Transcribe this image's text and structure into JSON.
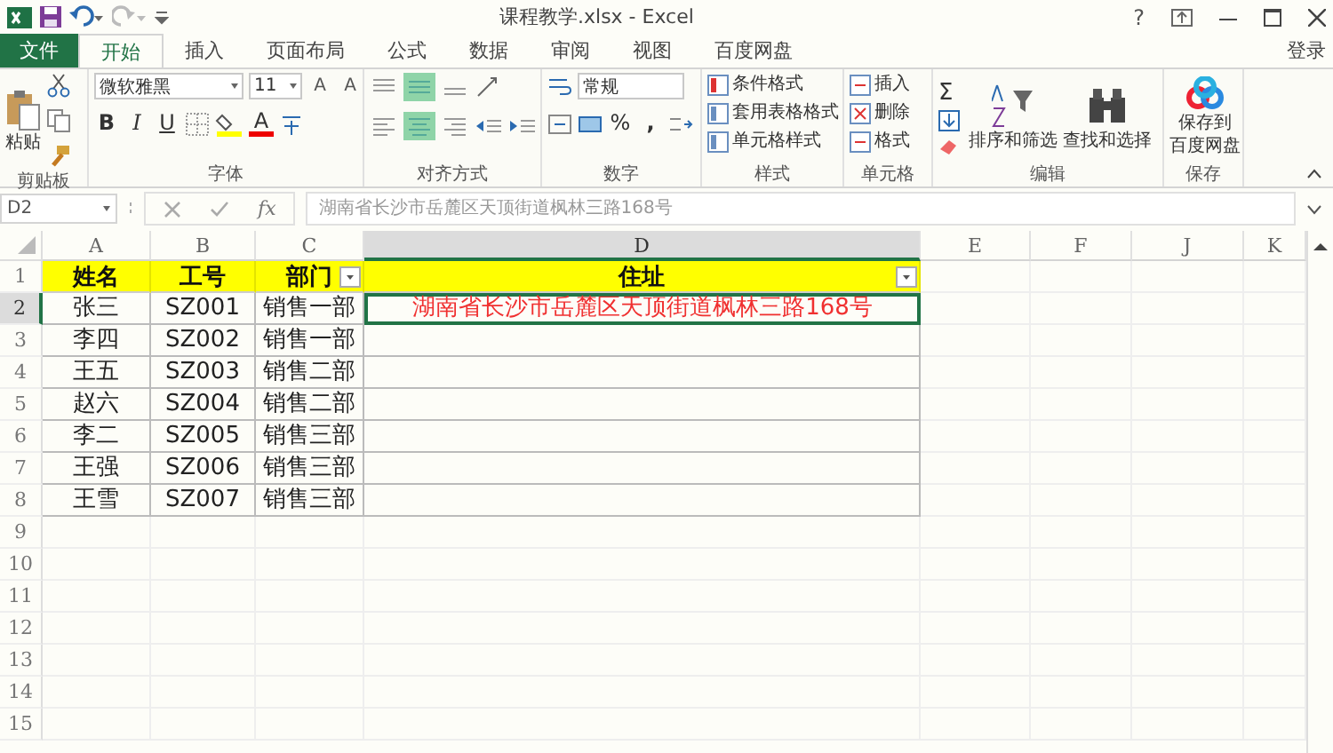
{
  "window": {
    "title": "课程教学.xlsx - Excel",
    "help": "?"
  },
  "tabs": [
    {
      "label": "文件",
      "kind": "file",
      "selected": false
    },
    {
      "label": "开始",
      "kind": "tab",
      "selected": true
    },
    {
      "label": "插入",
      "kind": "tab",
      "selected": false
    },
    {
      "label": "页面布局",
      "kind": "tab",
      "selected": false
    },
    {
      "label": "公式",
      "kind": "tab",
      "selected": false
    },
    {
      "label": "数据",
      "kind": "tab",
      "selected": false
    },
    {
      "label": "审阅",
      "kind": "tab",
      "selected": false
    },
    {
      "label": "视图",
      "kind": "tab",
      "selected": false
    },
    {
      "label": "百度网盘",
      "kind": "tab",
      "selected": false
    }
  ],
  "sign_in": "登录",
  "ribbon": {
    "clipboard": {
      "label": "剪贴板",
      "paste": "粘贴"
    },
    "font": {
      "label": "字体",
      "name": "微软雅黑",
      "size": "11",
      "grow": "A",
      "shrink": "A",
      "bold": "B",
      "italic": "I",
      "underline": "U",
      "font_color": "A"
    },
    "alignment": {
      "label": "对齐方式"
    },
    "number": {
      "label": "数字",
      "format": "常规",
      "percent": "%",
      "comma": ","
    },
    "styles": {
      "label": "样式",
      "items": [
        "条件格式",
        "套用表格格式",
        "单元格样式"
      ]
    },
    "cells": {
      "label": "单元格",
      "items": [
        "插入",
        "删除",
        "格式"
      ]
    },
    "editing": {
      "label": "编辑",
      "sum": "Σ",
      "sort": "排序和筛选",
      "find": "查找和选择"
    },
    "save": {
      "label": "保存",
      "lines": [
        "保存到",
        "百度网盘"
      ]
    }
  },
  "formula_bar": {
    "name_box": "D2",
    "fx": "fx",
    "content": "湖南省长沙市岳麓区天顶街道枫林三路168号"
  },
  "sheet": {
    "columns": [
      {
        "label": "A",
        "selected": false
      },
      {
        "label": "B",
        "selected": false
      },
      {
        "label": "C",
        "selected": false
      },
      {
        "label": "D",
        "selected": true
      },
      {
        "label": "E",
        "selected": false
      },
      {
        "label": "F",
        "selected": false
      },
      {
        "label": "J",
        "selected": false
      },
      {
        "label": "K",
        "selected": false
      }
    ],
    "header": {
      "number": "1",
      "selected": false,
      "cells": [
        {
          "text": "姓名",
          "filter": false
        },
        {
          "text": "工号",
          "filter": false
        },
        {
          "text": "部门",
          "filter": true
        },
        {
          "text": "住址",
          "filter": true
        }
      ]
    },
    "rows": [
      {
        "number": "2",
        "selected": true,
        "cells": [
          "张三",
          "SZ001",
          "销售一部",
          "湖南省长沙市岳麓区天顶街道枫林三路168号"
        ]
      },
      {
        "number": "3",
        "selected": false,
        "cells": [
          "李四",
          "SZ002",
          "销售一部"
        ]
      },
      {
        "number": "4",
        "selected": false,
        "cells": [
          "王五",
          "SZ003",
          "销售二部"
        ]
      },
      {
        "number": "5",
        "selected": false,
        "cells": [
          "赵六",
          "SZ004",
          "销售二部"
        ]
      },
      {
        "number": "6",
        "selected": false,
        "cells": [
          "李二",
          "SZ005",
          "销售三部"
        ]
      },
      {
        "number": "7",
        "selected": false,
        "cells": [
          "王强",
          "SZ006",
          "销售三部"
        ]
      },
      {
        "number": "8",
        "selected": false,
        "cells": [
          "王雪",
          "SZ007",
          "销售三部"
        ]
      }
    ],
    "empty_rows": [
      "9",
      "10",
      "11",
      "12",
      "13",
      "14",
      "15"
    ]
  }
}
